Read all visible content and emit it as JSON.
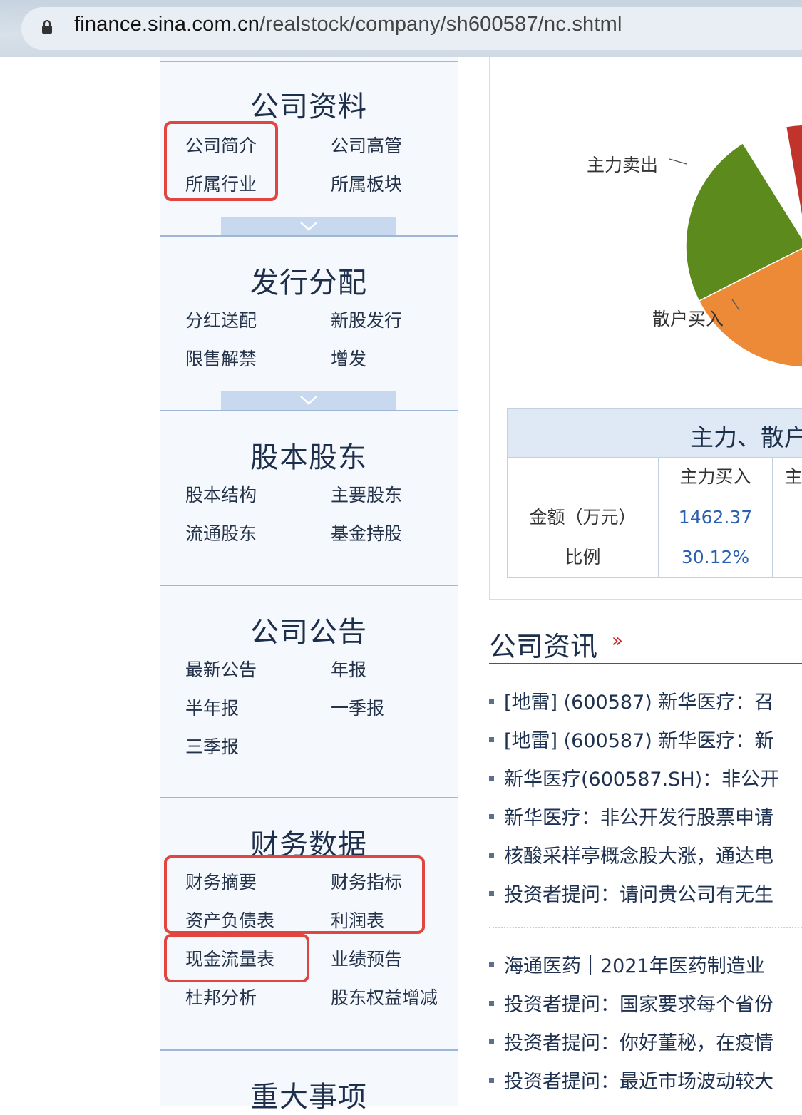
{
  "browser": {
    "url_host": "finance.sina.com.cn",
    "url_path": "/realstock/company/sh600587/nc.shtml"
  },
  "sidebar": {
    "sections": [
      {
        "title": "公司资料",
        "links": [
          "公司简介",
          "公司高管",
          "所属行业",
          "所属板块"
        ]
      },
      {
        "title": "发行分配",
        "links": [
          "分红送配",
          "新股发行",
          "限售解禁",
          "增发"
        ]
      },
      {
        "title": "股本股东",
        "links": [
          "股本结构",
          "主要股东",
          "流通股东",
          "基金持股"
        ]
      },
      {
        "title": "公司公告",
        "links": [
          "最新公告",
          "年报",
          "半年报",
          "一季报",
          "三季报"
        ]
      },
      {
        "title": "财务数据",
        "links": [
          "财务摘要",
          "财务指标",
          "资产负债表",
          "利润表",
          "现金流量表",
          "业绩预告",
          "杜邦分析",
          "股东权益增减"
        ]
      },
      {
        "title": "重大事项",
        "links": []
      }
    ]
  },
  "pie": {
    "labels": [
      "主力卖出",
      "散户买入"
    ],
    "colors": {
      "red": "#c0342b",
      "green": "#5d8a1c",
      "orange": "#ec8a37"
    }
  },
  "flow_table": {
    "caption": "主力、散户",
    "headers": [
      "",
      "主力买入",
      "主"
    ],
    "rows": [
      {
        "label": "金额（万元）",
        "value": "1462.37"
      },
      {
        "label": "比例",
        "value": "30.12%"
      }
    ]
  },
  "news": {
    "title": "公司资讯",
    "more": "»",
    "items": [
      "[地雷] (600587) 新华医疗：召",
      "[地雷] (600587) 新华医疗：新",
      "新华医疗(600587.SH)：非公开",
      "新华医疗：非公开发行股票申请",
      "核酸采样亭概念股大涨，通达电",
      "投资者提问：请问贵公司有无生",
      "海通医药｜2021年医药制造业",
      "投资者提问：国家要求每个省份",
      "投资者提问：你好董秘，在疫情",
      "投资者提问：最近市场波动较大"
    ]
  }
}
